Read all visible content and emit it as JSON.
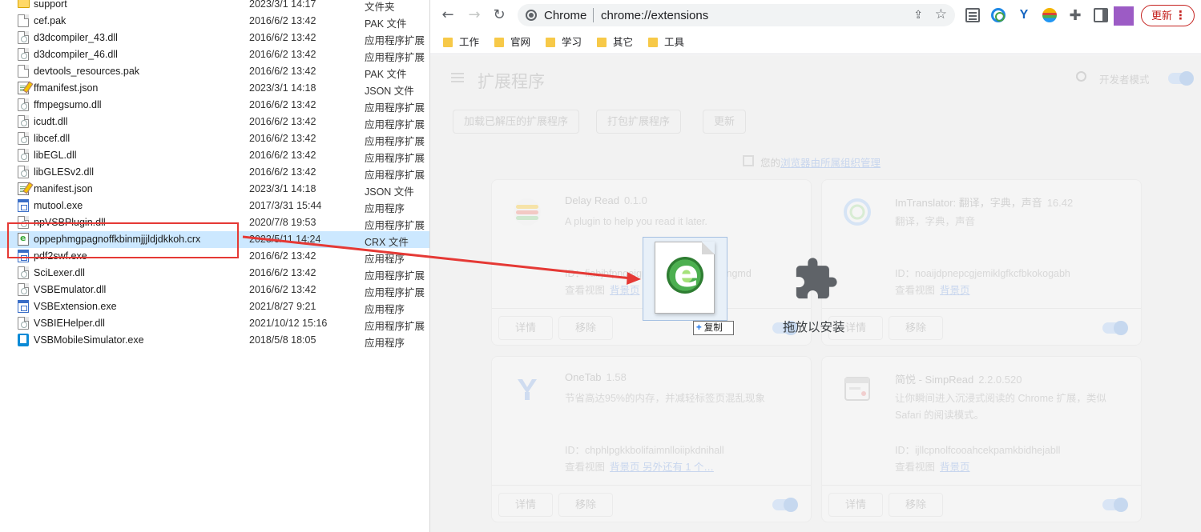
{
  "explorer": {
    "files": [
      {
        "name": "support",
        "date": "2023/3/1 14:17",
        "type": "文件夹",
        "icon": "folder-icon"
      },
      {
        "name": "cef.pak",
        "date": "2016/6/2 13:42",
        "type": "PAK 文件",
        "icon": "file-icon"
      },
      {
        "name": "d3dcompiler_43.dll",
        "date": "2016/6/2 13:42",
        "type": "应用程序扩展",
        "icon": "dll-icon"
      },
      {
        "name": "d3dcompiler_46.dll",
        "date": "2016/6/2 13:42",
        "type": "应用程序扩展",
        "icon": "dll-icon"
      },
      {
        "name": "devtools_resources.pak",
        "date": "2016/6/2 13:42",
        "type": "PAK 文件",
        "icon": "file-icon"
      },
      {
        "name": "ffmanifest.json",
        "date": "2023/3/1 14:18",
        "type": "JSON 文件",
        "icon": "json-icon"
      },
      {
        "name": "ffmpegsumo.dll",
        "date": "2016/6/2 13:42",
        "type": "应用程序扩展",
        "icon": "dll-icon"
      },
      {
        "name": "icudt.dll",
        "date": "2016/6/2 13:42",
        "type": "应用程序扩展",
        "icon": "dll-icon"
      },
      {
        "name": "libcef.dll",
        "date": "2016/6/2 13:42",
        "type": "应用程序扩展",
        "icon": "dll-icon"
      },
      {
        "name": "libEGL.dll",
        "date": "2016/6/2 13:42",
        "type": "应用程序扩展",
        "icon": "dll-icon"
      },
      {
        "name": "libGLESv2.dll",
        "date": "2016/6/2 13:42",
        "type": "应用程序扩展",
        "icon": "dll-icon"
      },
      {
        "name": "manifest.json",
        "date": "2023/3/1 14:18",
        "type": "JSON 文件",
        "icon": "json-icon"
      },
      {
        "name": "mutool.exe",
        "date": "2017/3/31 15:44",
        "type": "应用程序",
        "icon": "exe-icon"
      },
      {
        "name": "npVSBPlugin.dll",
        "date": "2020/7/8 19:53",
        "type": "应用程序扩展",
        "icon": "dll-icon"
      },
      {
        "name": "oppephmgpagnoffkbinmjjjldjdkkoh.crx",
        "date": "2023/5/11 14:24",
        "type": "CRX 文件",
        "icon": "crx-icon",
        "selected": true
      },
      {
        "name": "pdf2swf.exe",
        "date": "2016/6/2 13:42",
        "type": "应用程序",
        "icon": "exe-icon"
      },
      {
        "name": "SciLexer.dll",
        "date": "2016/6/2 13:42",
        "type": "应用程序扩展",
        "icon": "dll-icon"
      },
      {
        "name": "VSBEmulator.dll",
        "date": "2016/6/2 13:42",
        "type": "应用程序扩展",
        "icon": "dll-icon"
      },
      {
        "name": "VSBExtension.exe",
        "date": "2021/8/27 9:21",
        "type": "应用程序",
        "icon": "exe-icon"
      },
      {
        "name": "VSBIEHelper.dll",
        "date": "2021/10/12 15:16",
        "type": "应用程序扩展",
        "icon": "dll-icon"
      },
      {
        "name": "VSBMobileSimulator.exe",
        "date": "2018/5/8 18:05",
        "type": "应用程序",
        "icon": "mobile-icon"
      }
    ]
  },
  "chrome": {
    "omnibox": {
      "chip": "Chrome",
      "url": "chrome://extensions"
    },
    "update_label": "更新",
    "bookmarks": [
      "工作",
      "官网",
      "学习",
      "其它",
      "工具"
    ],
    "accent_color": "#c5221f",
    "profile_color": "#9c5bc5"
  },
  "extensions_page": {
    "title": "扩展程序",
    "dev_mode_label": "开发者模式",
    "buttons": {
      "load_unpacked": "加载已解压的扩展程序",
      "pack": "打包扩展程序",
      "update": "更新"
    },
    "managed_note": {
      "text": "您的",
      "link": "浏览器由所属组织管理"
    },
    "cards": [
      {
        "name": "Delay Read",
        "version": "0.1.0",
        "desc": "A plugin to help you read it later.",
        "id": "ID：fiabjbfpngeigpgkmnpcmpenejpbngmd",
        "views_label": "查看视图",
        "views_link": "背景页",
        "detail": "详情",
        "remove": "移除",
        "icon": "delay-read-icon"
      },
      {
        "name": "ImTranslator: 翻译，字典，声音",
        "version": "16.42",
        "desc": "翻译，字典，声音",
        "id": "ID：noaijdpnepcgjemiklgfkcfbkokogabh",
        "views_label": "查看视图",
        "views_link": "背景页",
        "detail": "详情",
        "remove": "移除",
        "icon": "imtranslator-icon"
      },
      {
        "name": "OneTab",
        "version": "1.58",
        "desc": "节省高达95%的内存，并减轻标签页混乱现象",
        "id": "ID：chphlpgkkbolifaimnlloiipkdnihall",
        "views_label": "查看视图",
        "views_link": "背景页 另外还有 1 个…",
        "detail": "详情",
        "remove": "移除",
        "icon": "onetab-icon"
      },
      {
        "name": "简悦 - SimpRead",
        "version": "2.2.0.520",
        "desc": "让你瞬间进入沉浸式阅读的 Chrome 扩展，类似 Safari 的阅读模式。",
        "id": "ID：ijllcpnolfcooahcekpamkbidhejabll",
        "views_label": "查看视图",
        "views_link": "背景页",
        "detail": "详情",
        "remove": "移除",
        "icon": "simpread-icon"
      }
    ]
  },
  "drag": {
    "copy_label": "复制",
    "drop_label": "拖放以安装"
  }
}
